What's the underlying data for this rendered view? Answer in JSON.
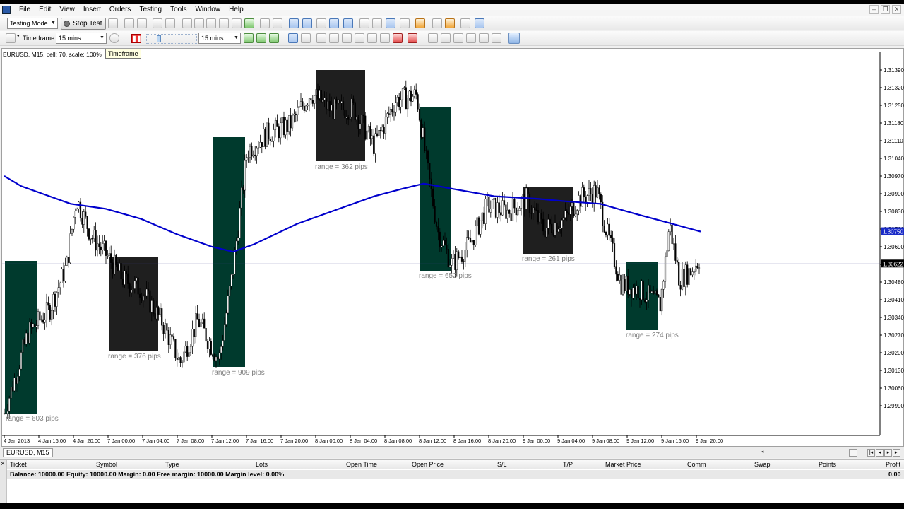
{
  "menu": [
    "File",
    "Edit",
    "View",
    "Insert",
    "Orders",
    "Testing",
    "Tools",
    "Window",
    "Help"
  ],
  "toolbar": {
    "mode_select": "Testing Mode",
    "stop_test_label": "Stop Test",
    "timeframe_label": "Time frame:",
    "timeframe_value": "15 mins",
    "timeframe_value_2": "15 mins",
    "tooltip": "Timeframe"
  },
  "chart": {
    "info": "EURUSD, M15, cell: 70, scale: 100%",
    "colors": {
      "bull_box": "#003a2d",
      "bear_box": "#1f1f1f",
      "ma_line": "#0000cc",
      "price_badge": "#1a2bc7",
      "bid_badge": "#000000"
    },
    "price_labels": [
      "1.31390",
      "1.31320",
      "1.31250",
      "1.31180",
      "1.31110",
      "1.31040",
      "1.30970",
      "1.30900",
      "1.30830",
      "1.30760",
      "1.30690",
      "1.30622",
      "1.30550",
      "1.30480",
      "1.30410",
      "1.30340",
      "1.30270",
      "1.30200",
      "1.30130",
      "1.30060",
      "1.29990"
    ],
    "ma_badge": "1.30750",
    "bid_badge": "1.30622",
    "time_labels": [
      "4 Jan 2013",
      "4 Jan 16:00",
      "4 Jan 20:00",
      "7 Jan 00:00",
      "7 Jan 04:00",
      "7 Jan 08:00",
      "7 Jan 12:00",
      "7 Jan 16:00",
      "7 Jan 20:00",
      "8 Jan 00:00",
      "8 Jan 04:00",
      "8 Jan 08:00",
      "8 Jan 12:00",
      "8 Jan 16:00",
      "8 Jan 20:00",
      "9 Jan 00:00",
      "9 Jan 04:00",
      "9 Jan 08:00",
      "9 Jan 12:00",
      "9 Jan 16:00",
      "9 Jan 20:00"
    ],
    "range_labels": [
      "range = 603 pips",
      "range = 376 pips",
      "range = 909 pips",
      "range = 362 pips",
      "range = 652 pips",
      "range = 261 pips",
      "range = 274 pips"
    ]
  },
  "chart_tab": "EURUSD, M15",
  "terminal": {
    "columns": [
      "Ticket",
      "Symbol",
      "Type",
      "Lots",
      "Open Time",
      "Open Price",
      "S/L",
      "T/P",
      "Market Price",
      "Comm",
      "Swap",
      "Points",
      "Profit"
    ],
    "balance_line": "Balance: 10000.00 Equity: 10000.00 Margin: 0.00 Free margin: 10000.00 Margin level: 0.00%",
    "profit_total": "0.00"
  }
}
